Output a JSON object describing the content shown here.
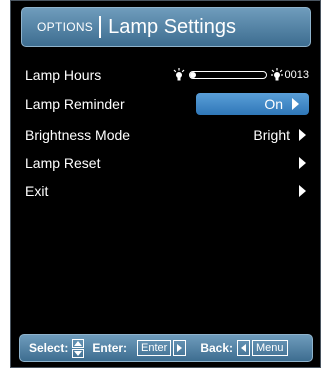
{
  "header": {
    "category": "OPTIONS",
    "title": "Lamp Settings"
  },
  "menu": {
    "lamp_hours": {
      "label": "Lamp Hours",
      "value": "0013",
      "progress_fraction": 0.03
    },
    "lamp_reminder": {
      "label": "Lamp Reminder",
      "value": "On"
    },
    "brightness_mode": {
      "label": "Brightness Mode",
      "value": "Bright"
    },
    "lamp_reset": {
      "label": "Lamp Reset"
    },
    "exit": {
      "label": "Exit"
    }
  },
  "footer": {
    "select_label": "Select:",
    "enter_label": "Enter:",
    "enter_key": "Enter",
    "back_label": "Back:",
    "menu_key": "Menu"
  },
  "colors": {
    "accent": "#3d7fbf",
    "panel_bg": "#000000",
    "header_bg": "#4f7fa3"
  }
}
